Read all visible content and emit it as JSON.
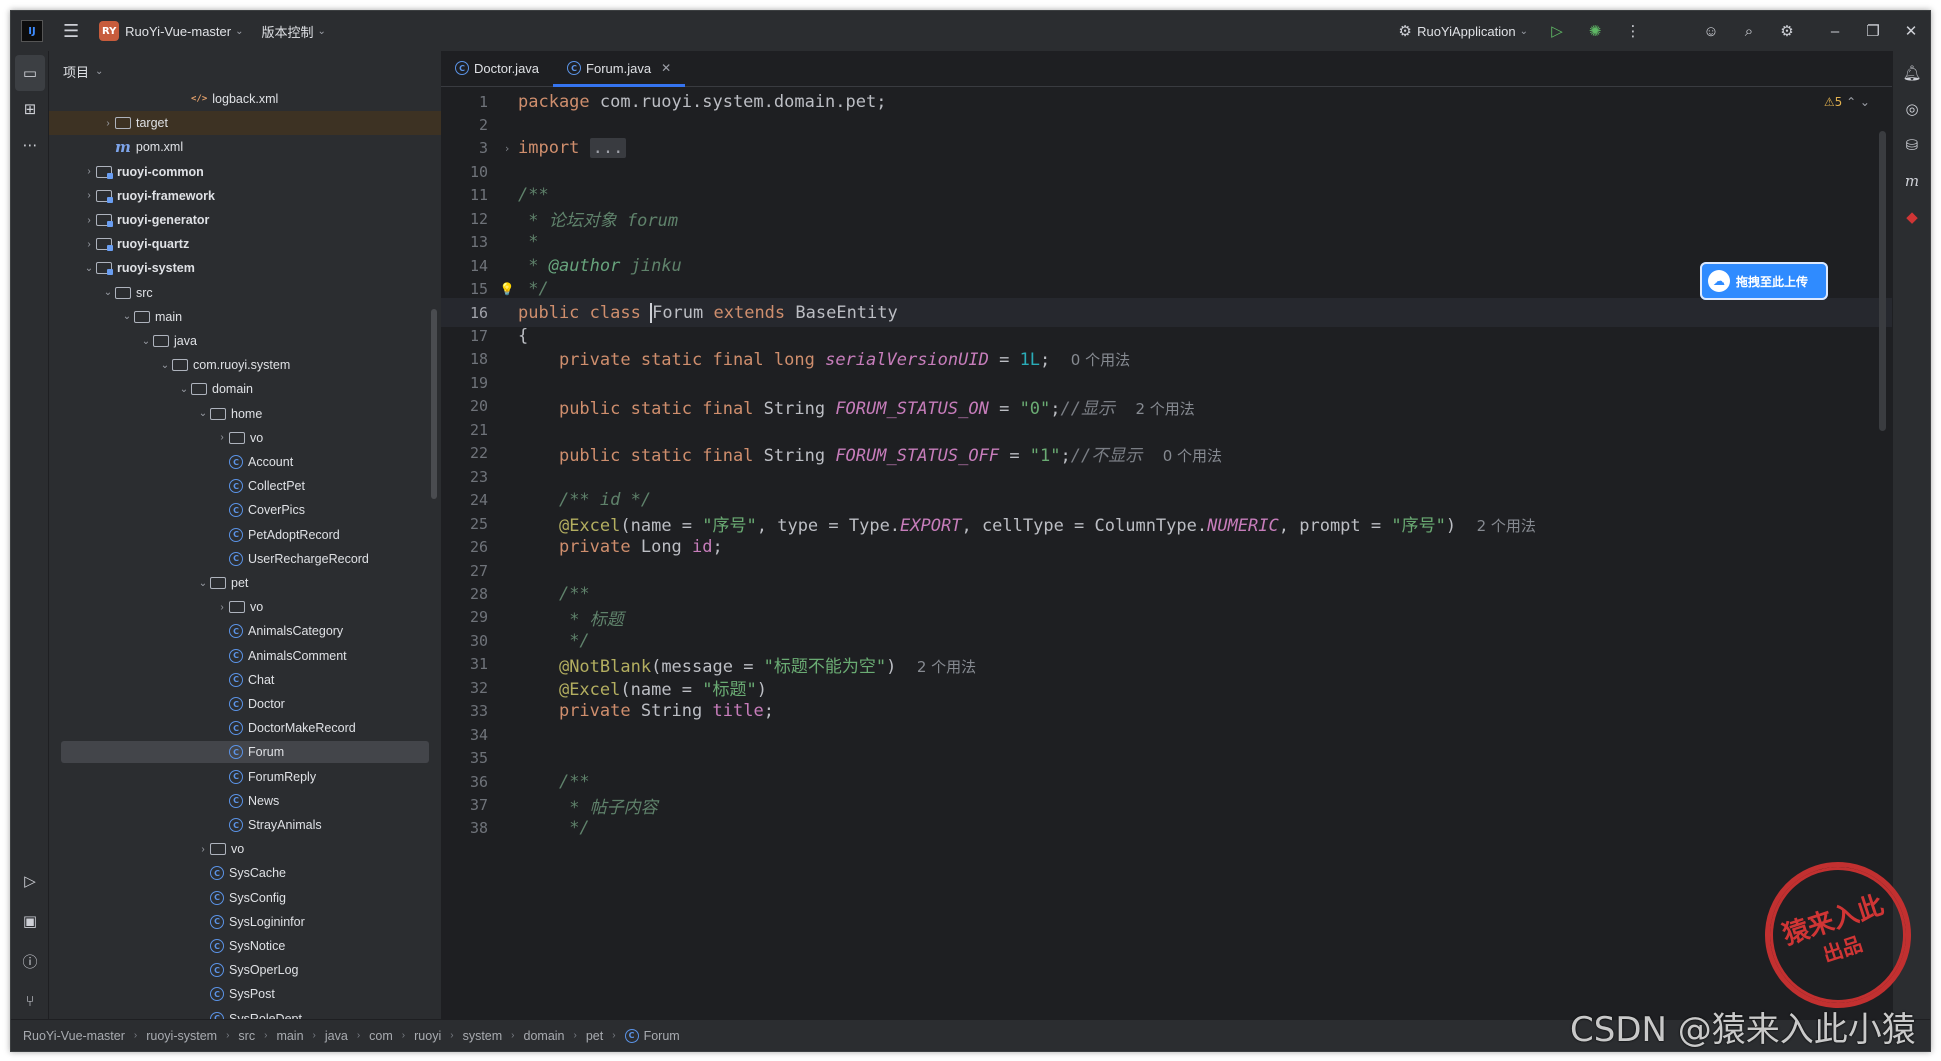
{
  "titlebar": {
    "project_badge": "RY",
    "project_name": "RuoYi-Vue-master",
    "vcs_label": "版本控制",
    "run_config": "RuoYiApplication"
  },
  "panel": {
    "title": "项目"
  },
  "tree": [
    {
      "label": "logback.xml",
      "kind": "xml",
      "depth": 6,
      "arrow": ""
    },
    {
      "label": "target",
      "kind": "folder",
      "depth": 2,
      "arrow": "›",
      "highlight": true
    },
    {
      "label": "pom.xml",
      "kind": "maven",
      "depth": 2,
      "arrow": ""
    },
    {
      "label": "ruoyi-common",
      "kind": "module",
      "depth": 1,
      "arrow": "›",
      "bold": true
    },
    {
      "label": "ruoyi-framework",
      "kind": "module",
      "depth": 1,
      "arrow": "›",
      "bold": true
    },
    {
      "label": "ruoyi-generator",
      "kind": "module",
      "depth": 1,
      "arrow": "›",
      "bold": true
    },
    {
      "label": "ruoyi-quartz",
      "kind": "module",
      "depth": 1,
      "arrow": "›",
      "bold": true
    },
    {
      "label": "ruoyi-system",
      "kind": "module",
      "depth": 1,
      "arrow": "⌄",
      "bold": true
    },
    {
      "label": "src",
      "kind": "folder",
      "depth": 2,
      "arrow": "⌄"
    },
    {
      "label": "main",
      "kind": "folder",
      "depth": 3,
      "arrow": "⌄"
    },
    {
      "label": "java",
      "kind": "folder",
      "depth": 4,
      "arrow": "⌄"
    },
    {
      "label": "com.ruoyi.system",
      "kind": "folder",
      "depth": 5,
      "arrow": "⌄"
    },
    {
      "label": "domain",
      "kind": "folder",
      "depth": 6,
      "arrow": "⌄"
    },
    {
      "label": "home",
      "kind": "folder",
      "depth": 7,
      "arrow": "⌄"
    },
    {
      "label": "vo",
      "kind": "folder",
      "depth": 8,
      "arrow": "›"
    },
    {
      "label": "Account",
      "kind": "class",
      "depth": 8,
      "arrow": ""
    },
    {
      "label": "CollectPet",
      "kind": "class",
      "depth": 8,
      "arrow": ""
    },
    {
      "label": "CoverPics",
      "kind": "class",
      "depth": 8,
      "arrow": ""
    },
    {
      "label": "PetAdoptRecord",
      "kind": "class",
      "depth": 8,
      "arrow": ""
    },
    {
      "label": "UserRechargeRecord",
      "kind": "class",
      "depth": 8,
      "arrow": ""
    },
    {
      "label": "pet",
      "kind": "folder",
      "depth": 7,
      "arrow": "⌄"
    },
    {
      "label": "vo",
      "kind": "folder",
      "depth": 8,
      "arrow": "›"
    },
    {
      "label": "AnimalsCategory",
      "kind": "class",
      "depth": 8,
      "arrow": ""
    },
    {
      "label": "AnimalsComment",
      "kind": "class",
      "depth": 8,
      "arrow": ""
    },
    {
      "label": "Chat",
      "kind": "class",
      "depth": 8,
      "arrow": ""
    },
    {
      "label": "Doctor",
      "kind": "class",
      "depth": 8,
      "arrow": ""
    },
    {
      "label": "DoctorMakeRecord",
      "kind": "class",
      "depth": 8,
      "arrow": ""
    },
    {
      "label": "Forum",
      "kind": "class",
      "depth": 8,
      "arrow": "",
      "selected": true
    },
    {
      "label": "ForumReply",
      "kind": "class",
      "depth": 8,
      "arrow": ""
    },
    {
      "label": "News",
      "kind": "class",
      "depth": 8,
      "arrow": ""
    },
    {
      "label": "StrayAnimals",
      "kind": "class",
      "depth": 8,
      "arrow": ""
    },
    {
      "label": "vo",
      "kind": "folder",
      "depth": 7,
      "arrow": "›"
    },
    {
      "label": "SysCache",
      "kind": "class",
      "depth": 7,
      "arrow": ""
    },
    {
      "label": "SysConfig",
      "kind": "class",
      "depth": 7,
      "arrow": ""
    },
    {
      "label": "SysLogininfor",
      "kind": "class",
      "depth": 7,
      "arrow": ""
    },
    {
      "label": "SysNotice",
      "kind": "class",
      "depth": 7,
      "arrow": ""
    },
    {
      "label": "SysOperLog",
      "kind": "class",
      "depth": 7,
      "arrow": ""
    },
    {
      "label": "SysPost",
      "kind": "class",
      "depth": 7,
      "arrow": ""
    },
    {
      "label": "SysRoleDept",
      "kind": "class",
      "depth": 7,
      "arrow": ""
    }
  ],
  "tabs": [
    {
      "label": "Doctor.java",
      "active": false
    },
    {
      "label": "Forum.java",
      "active": true
    }
  ],
  "warnings": "⚠5",
  "code_lines": [
    {
      "n": "1",
      "html": "<span class='kw'>package</span> com.ruoyi.system.domain.pet;"
    },
    {
      "n": "2",
      "html": ""
    },
    {
      "n": "3",
      "html": "<span class='kw'>import</span> <span class='foldbox'>...</span>",
      "fold": "›"
    },
    {
      "n": "10",
      "html": ""
    },
    {
      "n": "11",
      "html": "<span class='doc'>/**</span>"
    },
    {
      "n": "12",
      "html": "<span class='doc'> * 论坛对象 forum</span>"
    },
    {
      "n": "13",
      "html": "<span class='doc'> *</span>"
    },
    {
      "n": "14",
      "html": "<span class='doc'> * </span><span class='tag'>@author</span><span class='doc'> jinku</span>"
    },
    {
      "n": "15",
      "html": "<span class='doc'> */</span>"
    },
    {
      "n": "16",
      "html": "<span class='kw'>public class</span> <span class='caret'></span>Forum <span class='kw'>extends</span> BaseEntity",
      "current": true
    },
    {
      "n": "17",
      "html": "{"
    },
    {
      "n": "18",
      "html": "    <span class='kw'>private static final long</span> <span class='fld'>serialVersionUID</span> = <span class='num'>1L</span>;  <span class='hint'>0 个用法</span>"
    },
    {
      "n": "19",
      "html": ""
    },
    {
      "n": "20",
      "html": "    <span class='kw'>public static final</span> String <span class='fld'>FORUM_STATUS_ON</span> = <span class='str'>\"0\"</span>;<span class='cm'>//显示</span>  <span class='hint'>2 个用法</span>"
    },
    {
      "n": "21",
      "html": ""
    },
    {
      "n": "22",
      "html": "    <span class='kw'>public static final</span> String <span class='fld'>FORUM_STATUS_OFF</span> = <span class='str'>\"1\"</span>;<span class='cm'>//不显示</span>  <span class='hint'>0 个用法</span>"
    },
    {
      "n": "23",
      "html": ""
    },
    {
      "n": "24",
      "html": "    <span class='doc'>/** id */</span>"
    },
    {
      "n": "25",
      "html": "    <span class='ann'>@Excel</span>(name = <span class='str'>\"序号\"</span>, type = Type.<span class='fld'>EXPORT</span>, cellType = ColumnType.<span class='fld'>NUMERIC</span>, prompt = <span class='str'>\"序号\"</span>)  <span class='hint'>2 个用法</span>"
    },
    {
      "n": "26",
      "html": "    <span class='kw'>private</span> Long <span class='fld2'>id</span>;"
    },
    {
      "n": "27",
      "html": ""
    },
    {
      "n": "28",
      "html": "    <span class='doc'>/**</span>"
    },
    {
      "n": "29",
      "html": "    <span class='doc'> * 标题</span>"
    },
    {
      "n": "30",
      "html": "    <span class='doc'> */</span>"
    },
    {
      "n": "31",
      "html": "    <span class='ann'>@NotBlank</span>(message = <span class='str'>\"标题不能为空\"</span>)  <span class='hint'>2 个用法</span>"
    },
    {
      "n": "32",
      "html": "    <span class='ann'>@Excel</span>(name = <span class='str'>\"标题\"</span>)"
    },
    {
      "n": "33",
      "html": "    <span class='kw'>private</span> String <span class='fld2'>title</span>;"
    },
    {
      "n": "34",
      "html": ""
    },
    {
      "n": "35",
      "html": ""
    },
    {
      "n": "36",
      "html": "    <span class='doc'>/**</span>"
    },
    {
      "n": "37",
      "html": "    <span class='doc'> * 帖子内容</span>"
    },
    {
      "n": "38",
      "html": "    <span class='doc'> */</span>"
    }
  ],
  "breadcrumbs": [
    "RuoYi-Vue-master",
    "ruoyi-system",
    "src",
    "main",
    "java",
    "com",
    "ruoyi",
    "system",
    "domain",
    "pet",
    "Forum"
  ],
  "upload_button": "拖拽至此上传",
  "stamp_text": "猿来入此",
  "stamp_sub": "出品",
  "watermark": "CSDN @猿来入此小猿"
}
